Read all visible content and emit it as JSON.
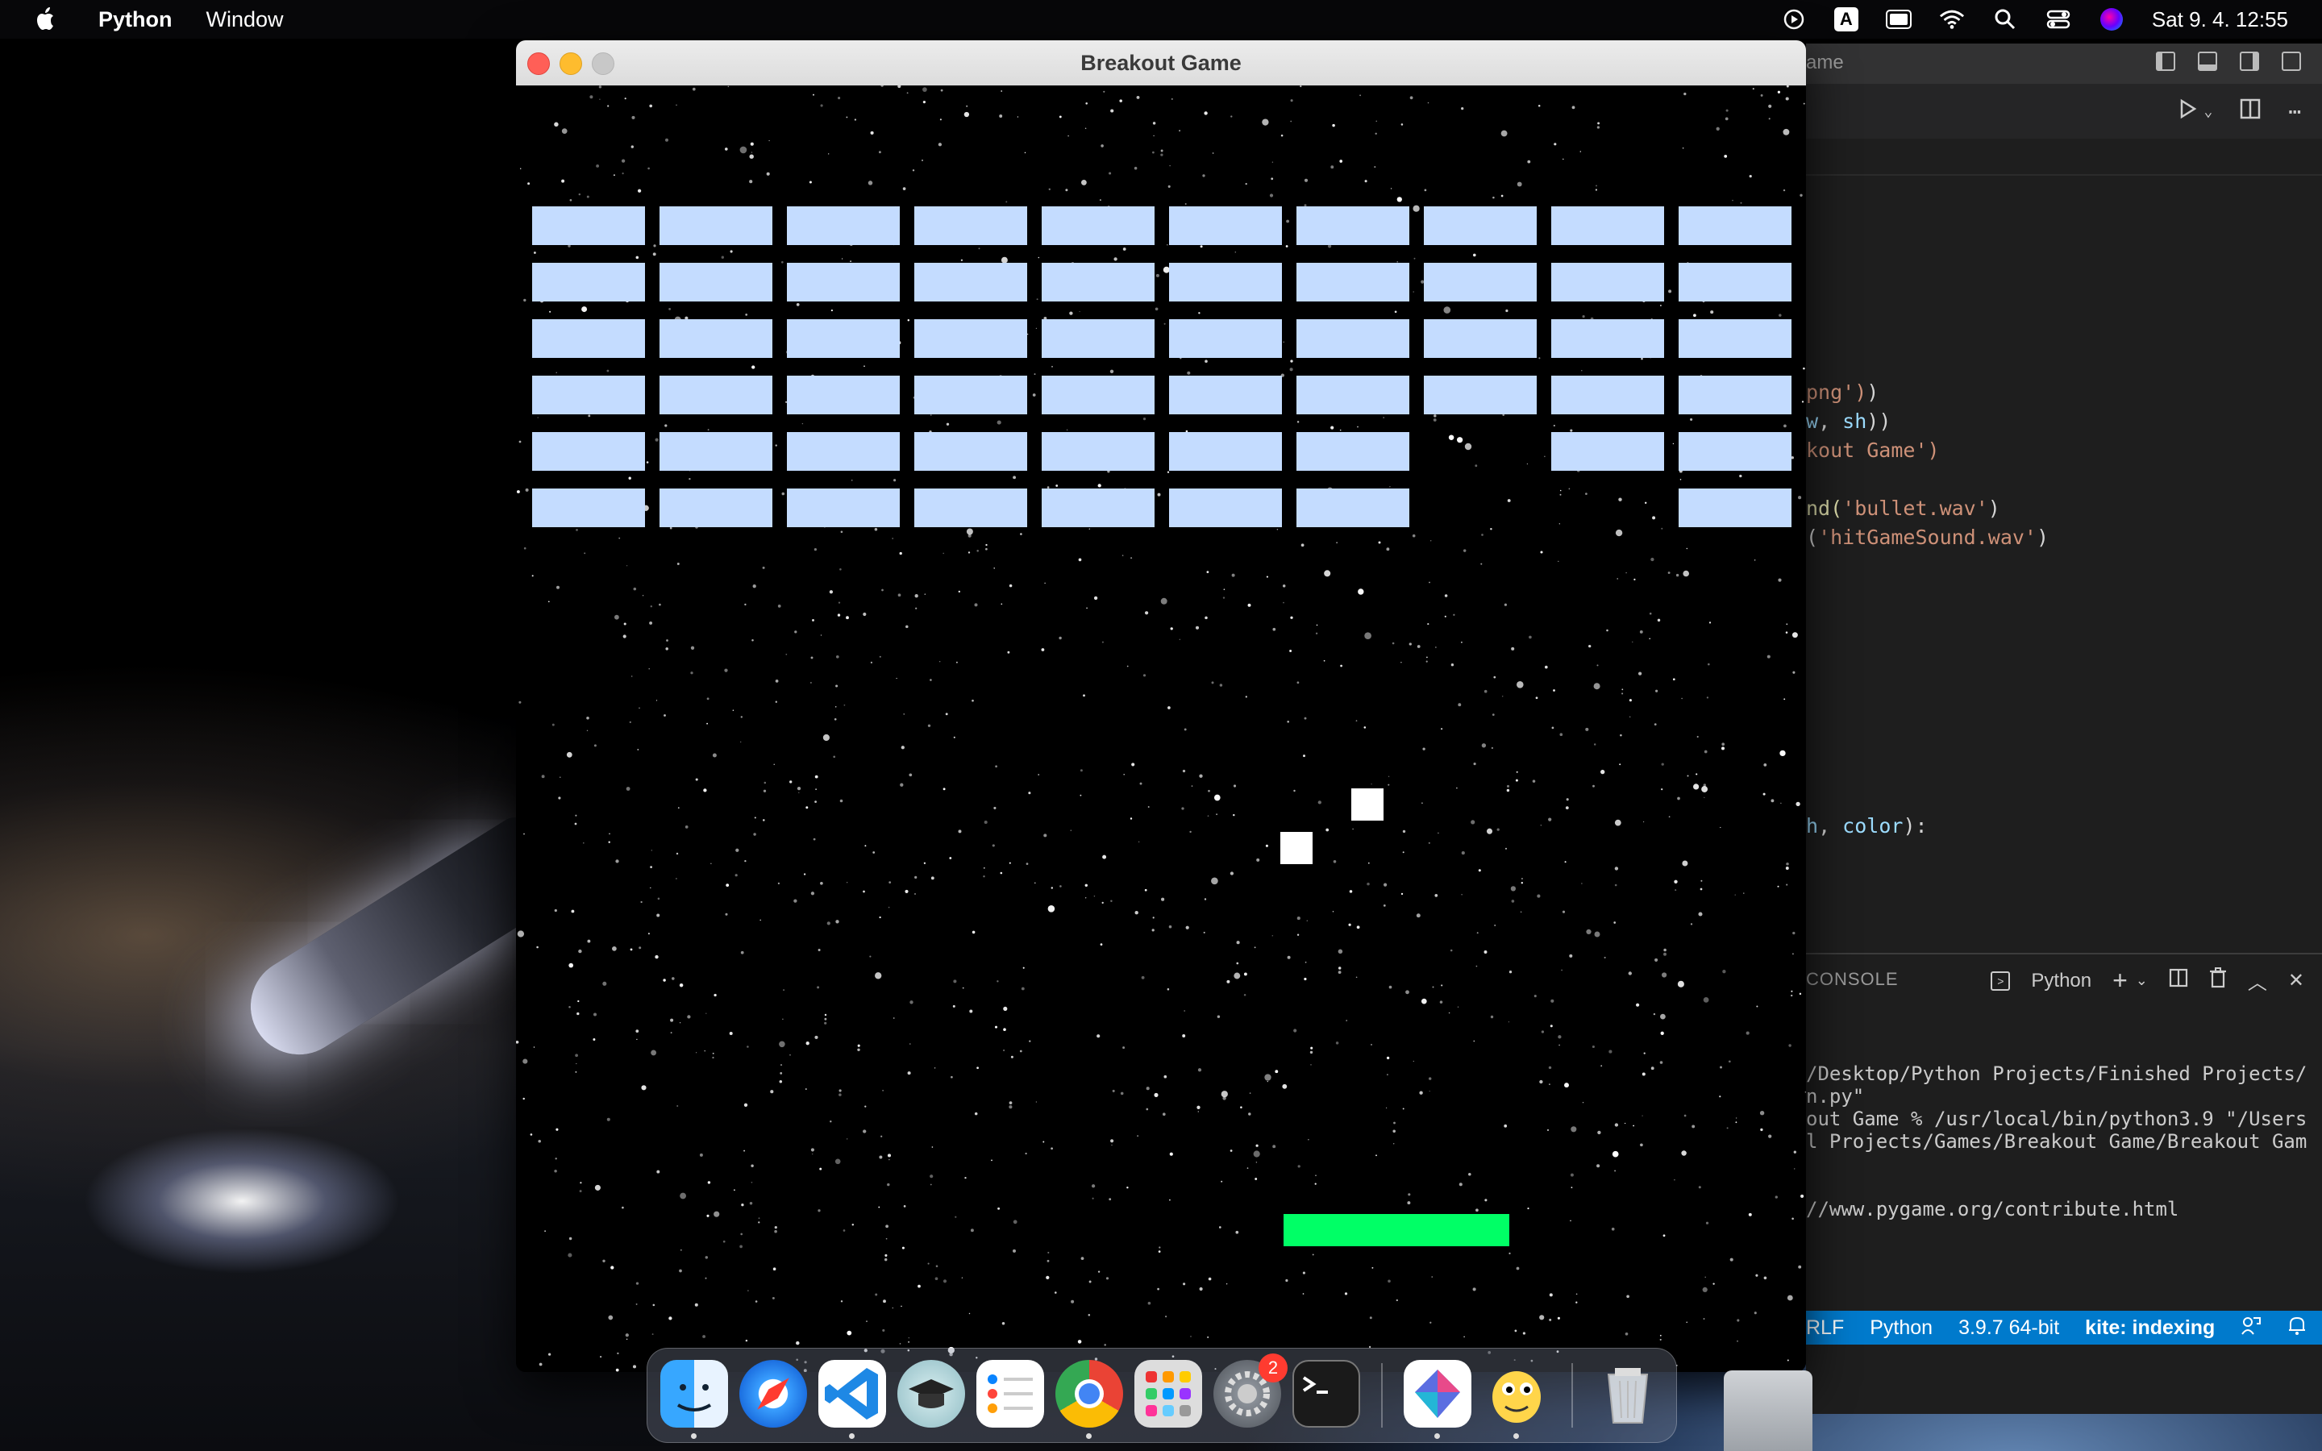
{
  "menubar": {
    "app_name": "Python",
    "menu_items": [
      "Window"
    ],
    "input_source": "A",
    "clock": "Sat 9. 4.  12:55"
  },
  "game_window": {
    "title": "Breakout Game",
    "bricks": {
      "color": "#c4dcff",
      "rows": 6,
      "cols": 10,
      "missing": [
        [
          4,
          7
        ],
        [
          5,
          7
        ],
        [
          5,
          8
        ]
      ]
    },
    "balls_color": "#ffffff",
    "paddle_color": "#00ff66"
  },
  "vscode": {
    "title_fragment": "ame",
    "code_lines": [
      {
        "parts": [
          {
            "t": "png')",
            "c": "str"
          },
          {
            "t": ")",
            "c": "pl"
          }
        ]
      },
      {
        "parts": [
          {
            "t": "w",
            "c": "var"
          },
          {
            "t": ", ",
            "c": "pl"
          },
          {
            "t": "sh",
            "c": "var"
          },
          {
            "t": "))",
            "c": "pl"
          }
        ]
      },
      {
        "parts": [
          {
            "t": "kout Game')",
            "c": "str"
          }
        ]
      },
      {
        "parts": []
      },
      {
        "parts": [
          {
            "t": "nd(",
            "c": "fn"
          },
          {
            "t": "'bullet.wav'",
            "c": "str"
          },
          {
            "t": ")",
            "c": "pl"
          }
        ]
      },
      {
        "parts": [
          {
            "t": "(",
            "c": "pl"
          },
          {
            "t": "'hitGameSound.wav'",
            "c": "str"
          },
          {
            "t": ")",
            "c": "pl"
          }
        ]
      }
    ],
    "code_line_fn": {
      "parts": [
        {
          "t": "h",
          "c": "var"
        },
        {
          "t": ", ",
          "c": "pl"
        },
        {
          "t": "color",
          "c": "var"
        },
        {
          "t": "):",
          "c": "pl"
        }
      ]
    },
    "panel": {
      "title": "CONSOLE",
      "terminal_name": "Python",
      "lines": [
        "/Desktop/Python Projects/Finished Projects/",
        "n.py\"",
        "out Game % /usr/local/bin/python3.9 \"/Users",
        "l Projects/Games/Breakout Game/Breakout Gam",
        "",
        "",
        "//www.pygame.org/contribute.html"
      ]
    },
    "statusbar": {
      "eol": "RLF",
      "language": "Python",
      "interpreter": "3.9.7 64-bit",
      "kite": "kite: indexing"
    }
  },
  "dock": {
    "apps": [
      "Finder",
      "Safari",
      "Visual Studio Code",
      "Student",
      "Reminders",
      "Google Chrome",
      "Launchpad",
      "System Preferences",
      "Terminal",
      "Python Launcher",
      "Python Game",
      "Trash"
    ],
    "system_preferences_badge": "2"
  }
}
